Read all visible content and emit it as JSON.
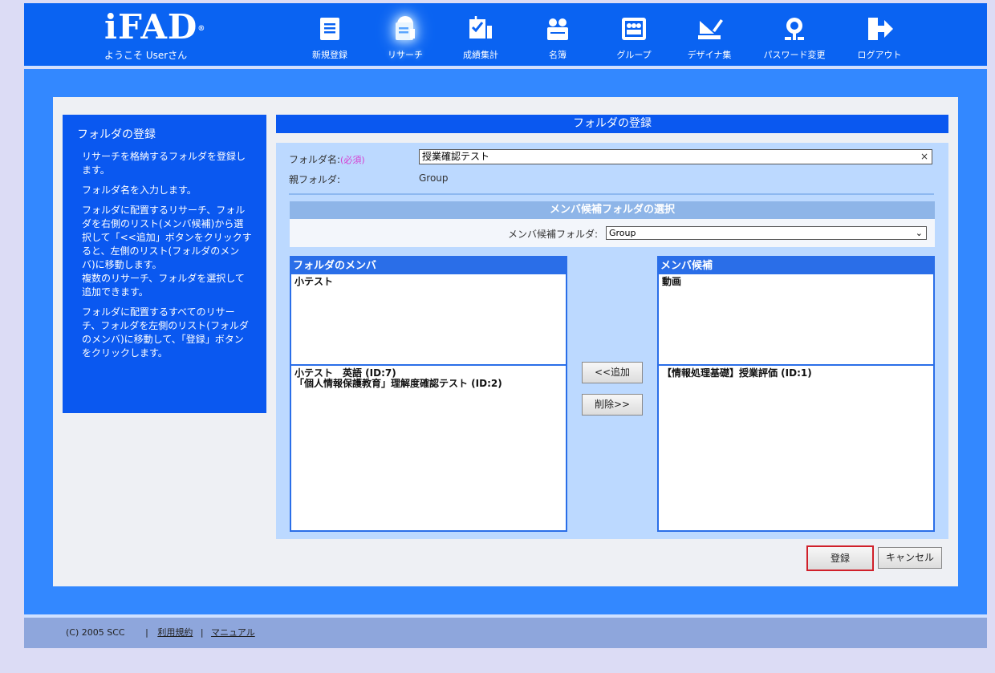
{
  "header": {
    "logo": "iFAD",
    "logo_mark": "®",
    "welcome": "ようこそ Userさん",
    "nav": [
      {
        "label": "新規登録",
        "icon": "new-document-icon"
      },
      {
        "label": "リサーチ",
        "icon": "research-icon",
        "active": true
      },
      {
        "label": "成績集計",
        "icon": "score-tally-icon"
      },
      {
        "label": "名簿",
        "icon": "roster-icon"
      },
      {
        "label": "グループ",
        "icon": "group-icon"
      },
      {
        "label": "デザイナ集",
        "icon": "designer-icon"
      },
      {
        "label": "パスワード変更",
        "icon": "password-key-icon"
      },
      {
        "label": "ログアウト",
        "icon": "logout-icon"
      }
    ]
  },
  "help": {
    "title": "フォルダの登録",
    "paragraphs": [
      "リサーチを格納するフォルダを登録します。",
      "フォルダ名を入力します。",
      "フォルダに配置するリサーチ、フォルダを右側のリスト(メンバ候補)から選択して「<<追加」ボタンをクリックすると、左側のリスト(フォルダのメンバ)に移動します。\n複数のリサーチ、フォルダを選択して追加できます。",
      "フォルダに配置するすべてのリサーチ、フォルダを左側のリスト(フォルダのメンバ)に移動して、「登録」ボタンをクリックします。"
    ]
  },
  "form": {
    "title": "フォルダの登録",
    "folder_name_label": "フォルダ名:",
    "required": "(必須)",
    "folder_name_value": "授業確認テスト",
    "clear": "×",
    "parent_label": "親フォルダ:",
    "parent_value": "Group",
    "candidate_section_title": "メンバ候補フォルダの選択",
    "candidate_folder_label": "メンバ候補フォルダ:",
    "candidate_folder_value": "Group"
  },
  "members": {
    "title": "フォルダのメンバ",
    "folders": [
      "小テスト"
    ],
    "items": [
      "小テスト　英語 (ID:7)",
      "「個人情報保護教育」理解度確認テスト (ID:2)"
    ]
  },
  "candidates": {
    "title": "メンバ候補",
    "folders": [
      "動画"
    ],
    "items": [
      "【情報処理基礎】授業評価 (ID:1)"
    ]
  },
  "buttons": {
    "add": "<<追加",
    "remove": "削除>>",
    "register": "登録",
    "cancel": "キャンセル"
  },
  "footer": {
    "copyright": "(C) 2005 SCC",
    "sep": "|",
    "terms": "利用規約",
    "manual": "マニュアル"
  },
  "colors": {
    "header_blue": "#0a63f2",
    "main_blue": "#3388ff",
    "panel_blue": "#0a58f0",
    "register_outline": "#d0202a"
  }
}
